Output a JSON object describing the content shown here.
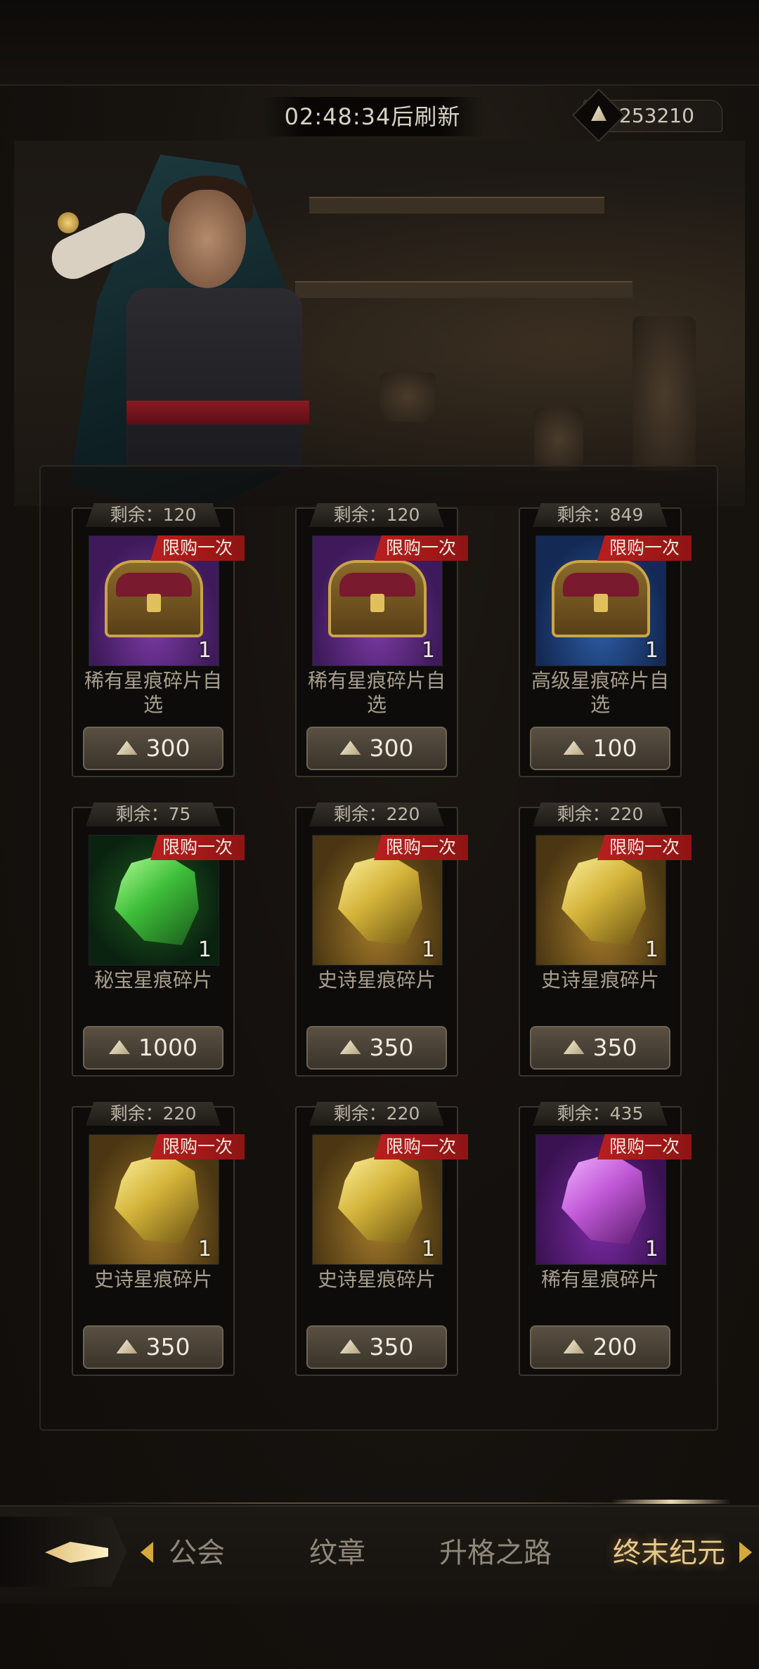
{
  "header": {
    "refresh_timer": "02:48:34后刷新",
    "currency_amount": "253210",
    "currency_icon": "diamond-gem-icon"
  },
  "items": [
    {
      "remaining": "剩余：120",
      "badge": "限购一次",
      "qty": "1",
      "name": "稀有星痕碎片自选",
      "price": "300",
      "icon": "chest-icon",
      "rarity": "purple"
    },
    {
      "remaining": "剩余：120",
      "badge": "限购一次",
      "qty": "1",
      "name": "稀有星痕碎片自选",
      "price": "300",
      "icon": "chest-icon",
      "rarity": "purple"
    },
    {
      "remaining": "剩余：849",
      "badge": "限购一次",
      "qty": "1",
      "name": "高级星痕碎片自选",
      "price": "100",
      "icon": "chest-icon",
      "rarity": "blue"
    },
    {
      "remaining": "剩余：75",
      "badge": "限购一次",
      "qty": "1",
      "name": "秘宝星痕碎片",
      "price": "1000",
      "icon": "crystal-shard-icon",
      "rarity": "green"
    },
    {
      "remaining": "剩余：220",
      "badge": "限购一次",
      "qty": "1",
      "name": "史诗星痕碎片",
      "price": "350",
      "icon": "crystal-shard-icon",
      "rarity": "gold"
    },
    {
      "remaining": "剩余：220",
      "badge": "限购一次",
      "qty": "1",
      "name": "史诗星痕碎片",
      "price": "350",
      "icon": "crystal-shard-icon",
      "rarity": "gold"
    },
    {
      "remaining": "剩余：220",
      "badge": "限购一次",
      "qty": "1",
      "name": "史诗星痕碎片",
      "price": "350",
      "icon": "crystal-shard-icon",
      "rarity": "gold"
    },
    {
      "remaining": "剩余：220",
      "badge": "限购一次",
      "qty": "1",
      "name": "史诗星痕碎片",
      "price": "350",
      "icon": "crystal-shard-icon",
      "rarity": "gold"
    },
    {
      "remaining": "剩余：435",
      "badge": "限购一次",
      "qty": "1",
      "name": "稀有星痕碎片",
      "price": "200",
      "icon": "crystal-shard-icon",
      "rarity": "violet"
    }
  ],
  "nav": {
    "tabs": [
      {
        "label": "公会"
      },
      {
        "label": "纹章"
      },
      {
        "label": "升格之路"
      },
      {
        "label": "终末纪元"
      }
    ],
    "active_tab": "终末纪元"
  },
  "colors": {
    "limit_badge": "#b81f1f",
    "active_tab": "#e6c98a",
    "inactive_tab": "#8f877a"
  }
}
